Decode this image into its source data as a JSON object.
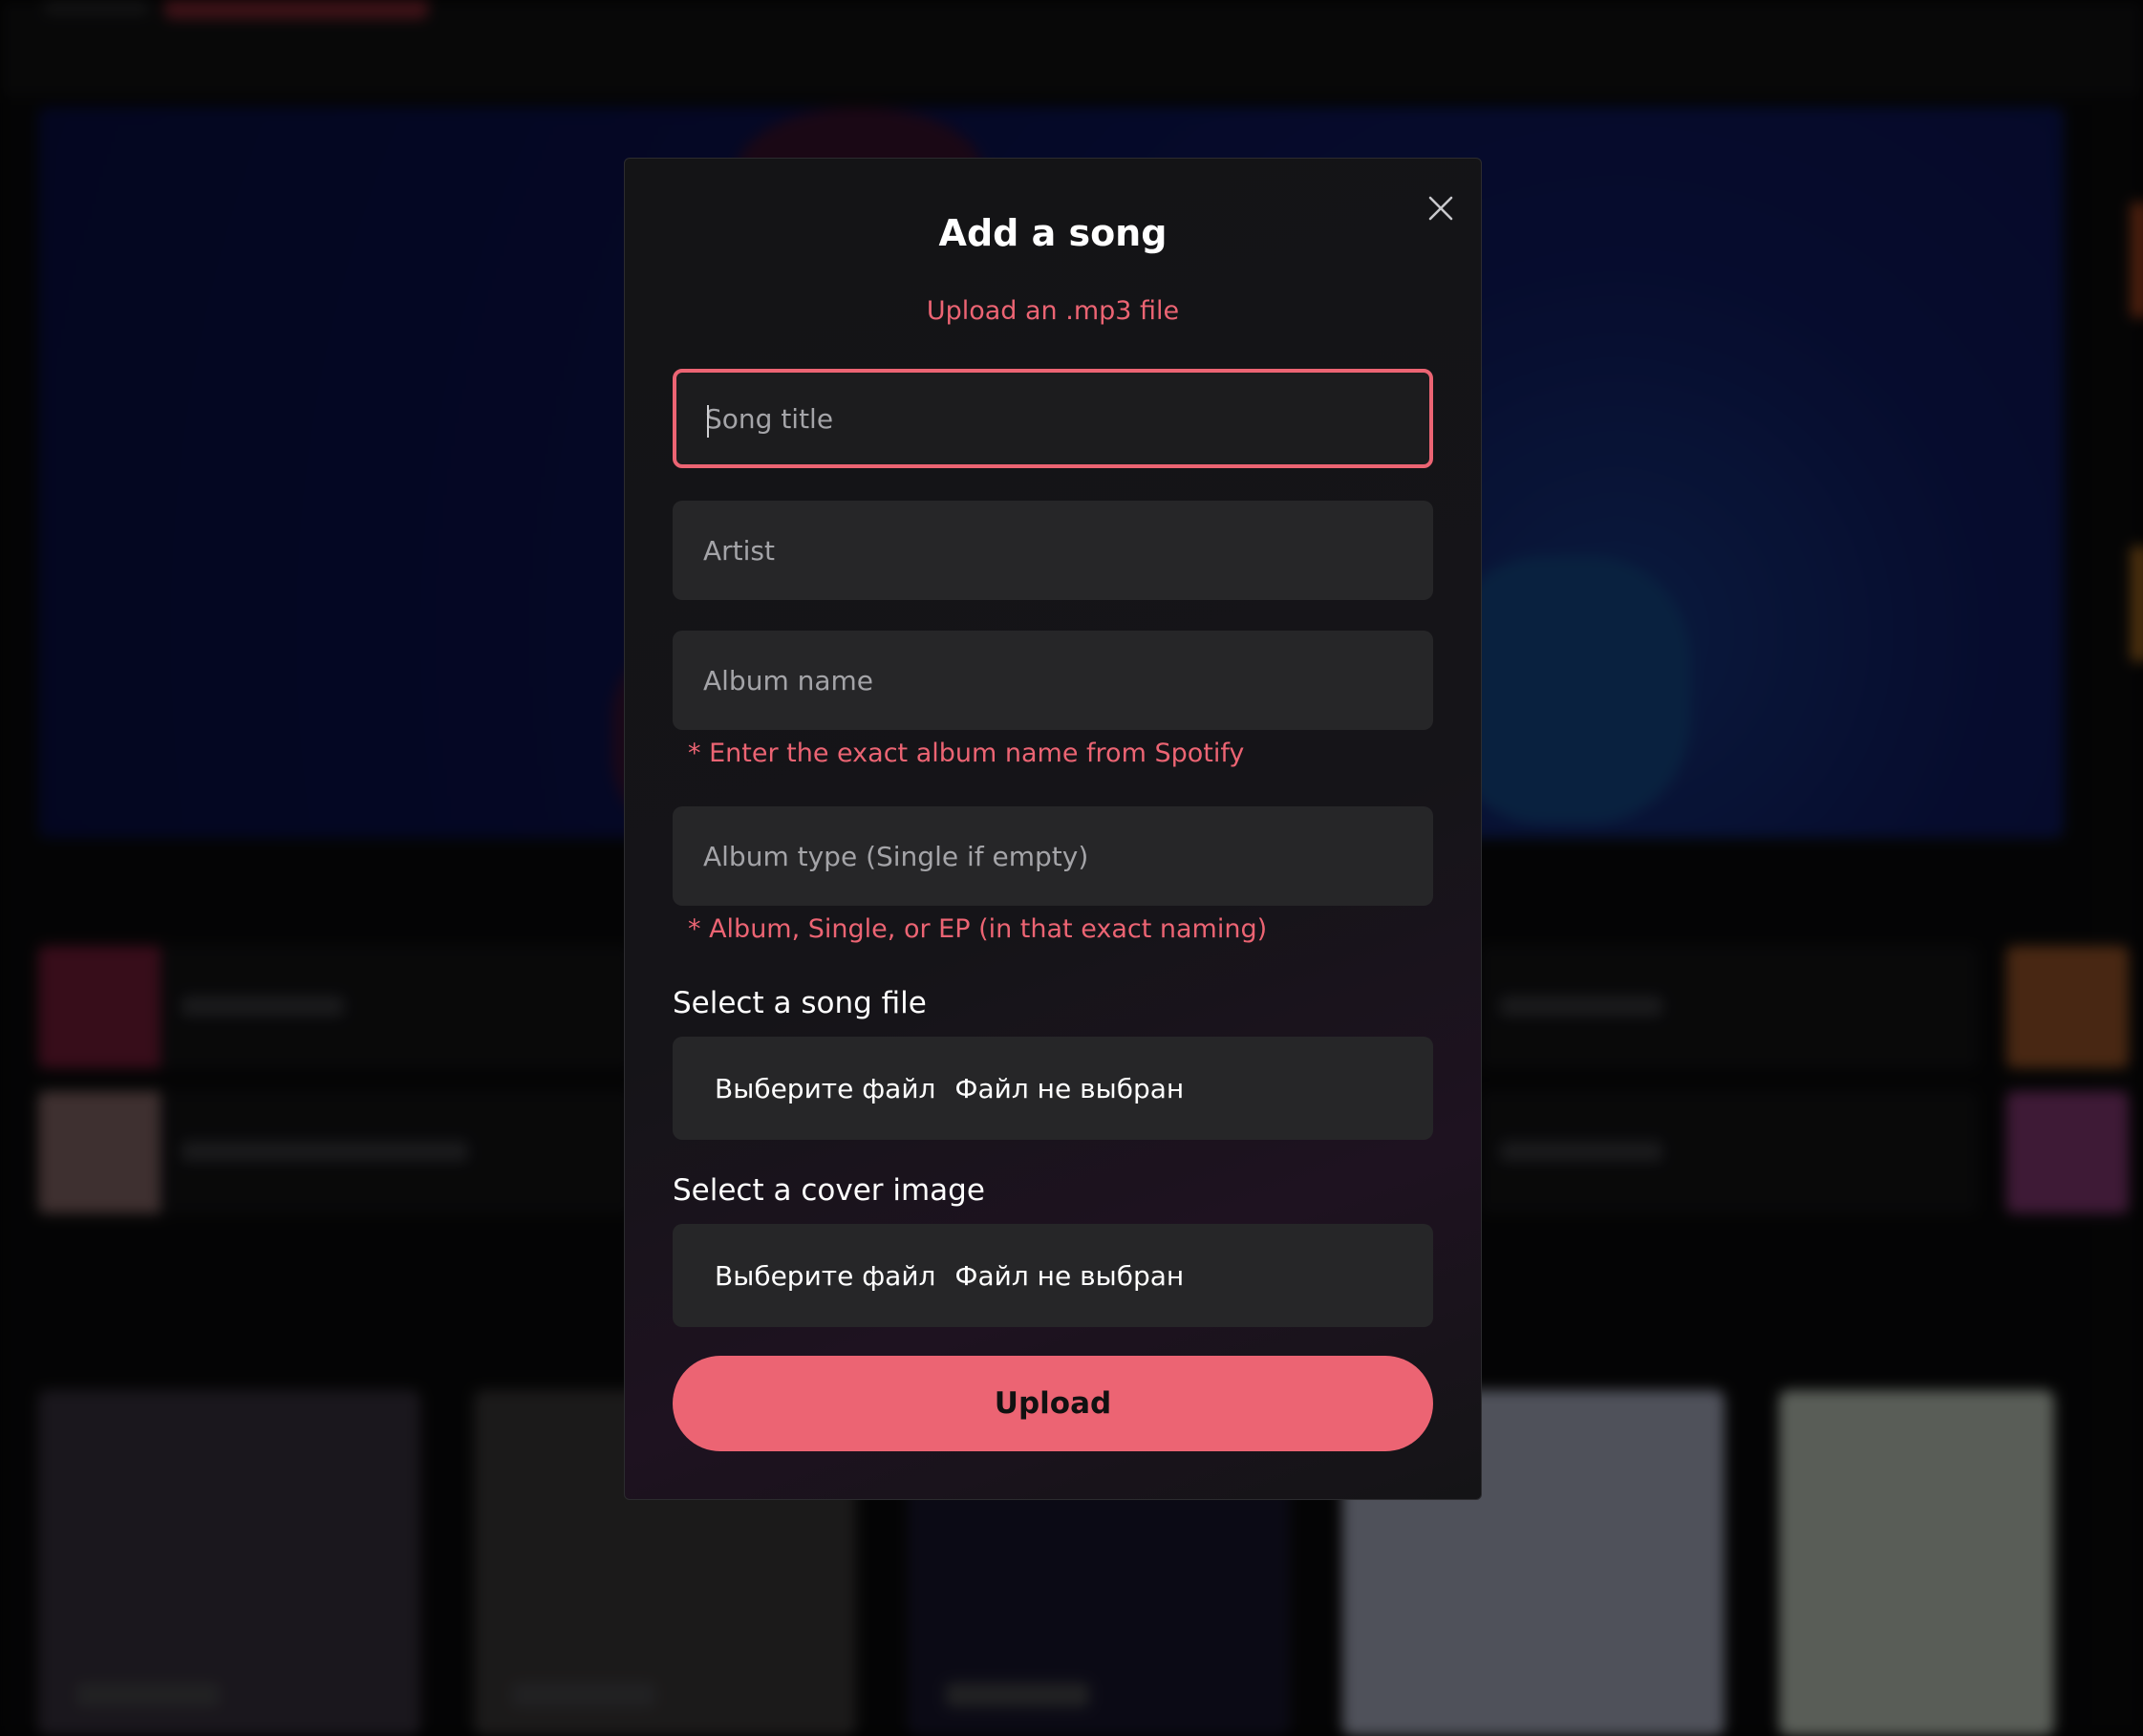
{
  "modal": {
    "title": "Add a song",
    "subtitle": "Upload an .mp3 file",
    "fields": {
      "song_title": {
        "placeholder": "Song title",
        "value": ""
      },
      "artist": {
        "placeholder": "Artist",
        "value": ""
      },
      "album_name": {
        "placeholder": "Album name",
        "value": ""
      },
      "album_type": {
        "placeholder": "Album type (Single if empty)",
        "value": ""
      }
    },
    "hints": {
      "album_name": "* Enter the exact album name from Spotify",
      "album_type": "* Album, Single, or EP (in that exact naming)"
    },
    "song_file": {
      "label": "Select a song file",
      "button_label": "Выберите файл",
      "status": "Файл не выбран"
    },
    "cover_image": {
      "label": "Select a cover image",
      "button_label": "Выберите файл",
      "status": "Файл не выбран"
    },
    "upload_label": "Upload",
    "close_icon": "close-icon"
  },
  "colors": {
    "accent": "#ec6473",
    "modal_bg": "#141416",
    "field_bg": "#262628",
    "text": "#ffffff"
  }
}
